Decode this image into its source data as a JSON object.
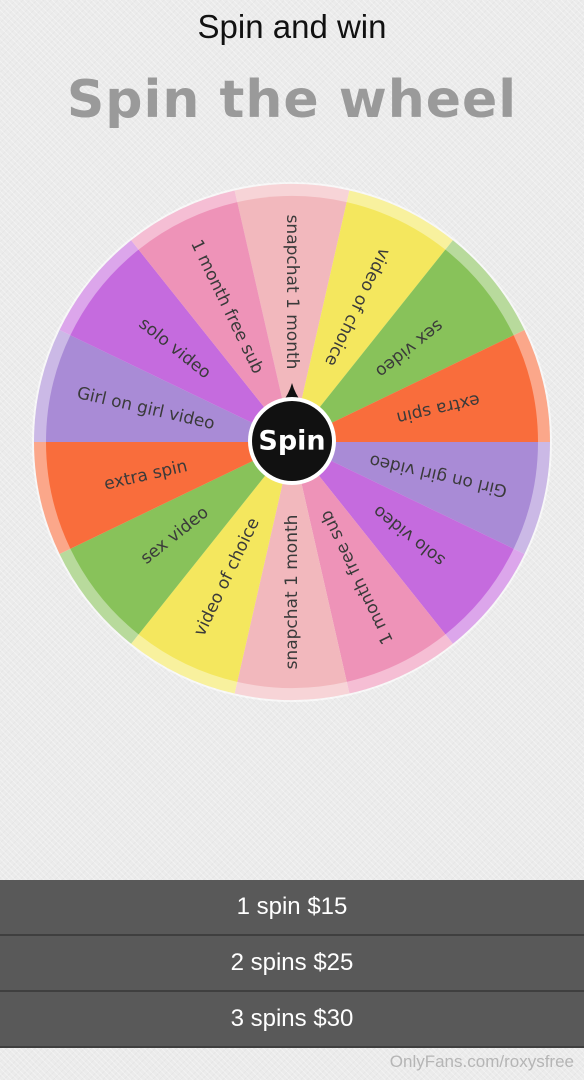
{
  "header": {
    "title": "Spin and win"
  },
  "main": {
    "title": "Spin the wheel"
  },
  "wheel": {
    "spin_label": "Spin",
    "segments": [
      {
        "label": "snapchat 1 month",
        "color": "#f2b8bd"
      },
      {
        "label": "video of choice",
        "color": "#f4e75e"
      },
      {
        "label": "sex video",
        "color": "#88c25a"
      },
      {
        "label": "extra spin",
        "color": "#f96d3c"
      },
      {
        "label": "Girl on girl video",
        "color": "#a98bd6"
      },
      {
        "label": "solo video",
        "color": "#c56bde"
      },
      {
        "label": "1 month free sub",
        "color": "#ee93b8"
      },
      {
        "label": "snapchat 1 month",
        "color": "#f2b8bd"
      },
      {
        "label": "video of choice",
        "color": "#f4e75e"
      },
      {
        "label": "sex video",
        "color": "#88c25a"
      },
      {
        "label": "extra spin",
        "color": "#f96d3c"
      },
      {
        "label": "Girl on girl video",
        "color": "#a98bd6"
      },
      {
        "label": "solo video",
        "color": "#c56bde"
      },
      {
        "label": "1 month free sub",
        "color": "#ee93b8"
      }
    ]
  },
  "options": [
    {
      "label": "1 spin $15"
    },
    {
      "label": "2 spins $25"
    },
    {
      "label": "3 spins $30"
    }
  ],
  "watermark": "OnlyFans.com/roxysfree"
}
